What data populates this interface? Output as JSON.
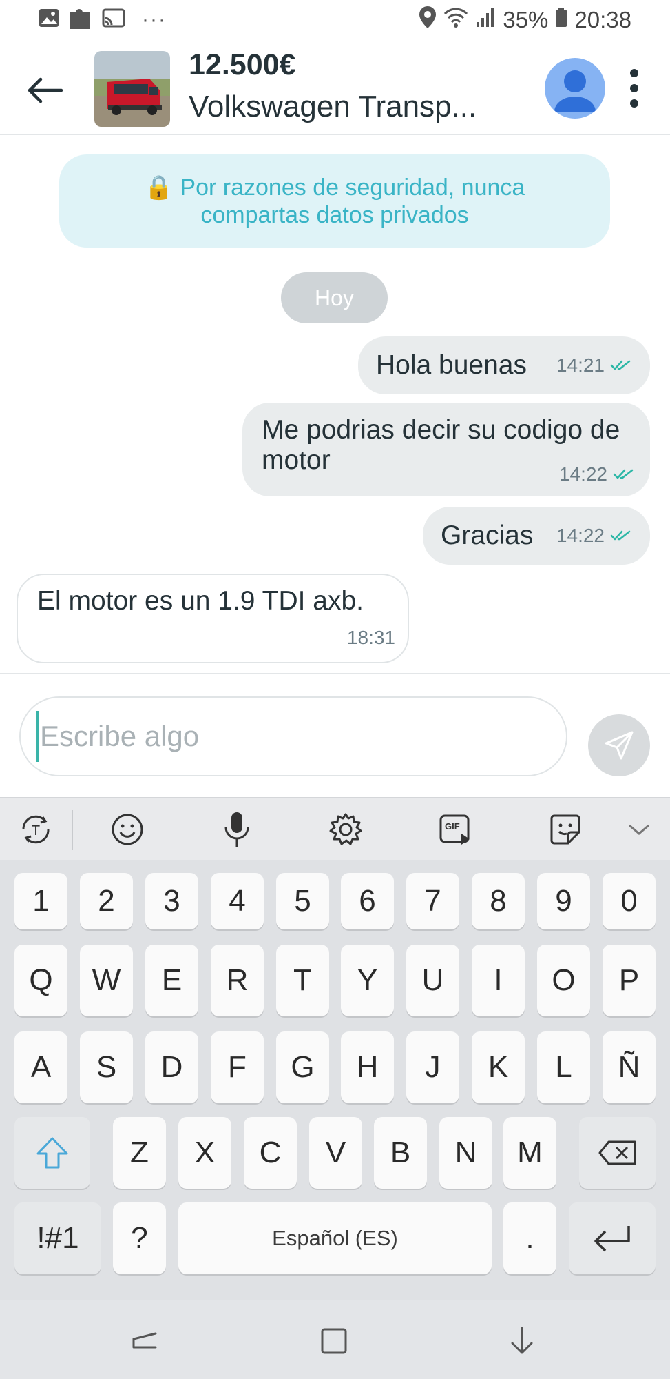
{
  "status_bar": {
    "battery": "35%",
    "time": "20:38",
    "overflow": "···"
  },
  "header": {
    "price": "12.500€",
    "title": "Volkswagen Transp...",
    "accent": "#86b3f3"
  },
  "chat": {
    "security_notice": "🔒 Por razones de seguridad, nunca compartas datos privados",
    "day_separator": "Hoy",
    "messages": [
      {
        "text": "Hola buenas",
        "time": "14:21",
        "sent": true
      },
      {
        "text": "Me podrias decir su codigo de motor",
        "time": "14:22",
        "sent": true
      },
      {
        "text": "Gracias",
        "time": "14:22",
        "sent": true
      },
      {
        "text": "El motor es un 1.9 TDI axb.",
        "time": "18:31",
        "sent": false
      }
    ]
  },
  "composer": {
    "placeholder": "Escribe algo"
  },
  "keyboard": {
    "row_numbers": [
      "1",
      "2",
      "3",
      "4",
      "5",
      "6",
      "7",
      "8",
      "9",
      "0"
    ],
    "row_1": [
      "Q",
      "W",
      "E",
      "R",
      "T",
      "Y",
      "U",
      "I",
      "O",
      "P"
    ],
    "row_2": [
      "A",
      "S",
      "D",
      "F",
      "G",
      "H",
      "J",
      "K",
      "L",
      "Ñ"
    ],
    "row_3": [
      "Z",
      "X",
      "C",
      "V",
      "B",
      "N",
      "M"
    ],
    "symbols_key": "!#1",
    "question_key": "?",
    "space_label": "Español (ES)",
    "period_key": ".",
    "gif_label": "GIF",
    "toolbar_icons": [
      "translate-icon",
      "emoji-icon",
      "microphone-icon",
      "settings-icon",
      "gif-icon",
      "sticker-icon",
      "collapse-icon"
    ]
  },
  "colors": {
    "tick": "#2bb7a6",
    "security_text": "#3ab4c6",
    "security_bg": "#dff3f7",
    "bubble_bg": "#e9eced"
  }
}
